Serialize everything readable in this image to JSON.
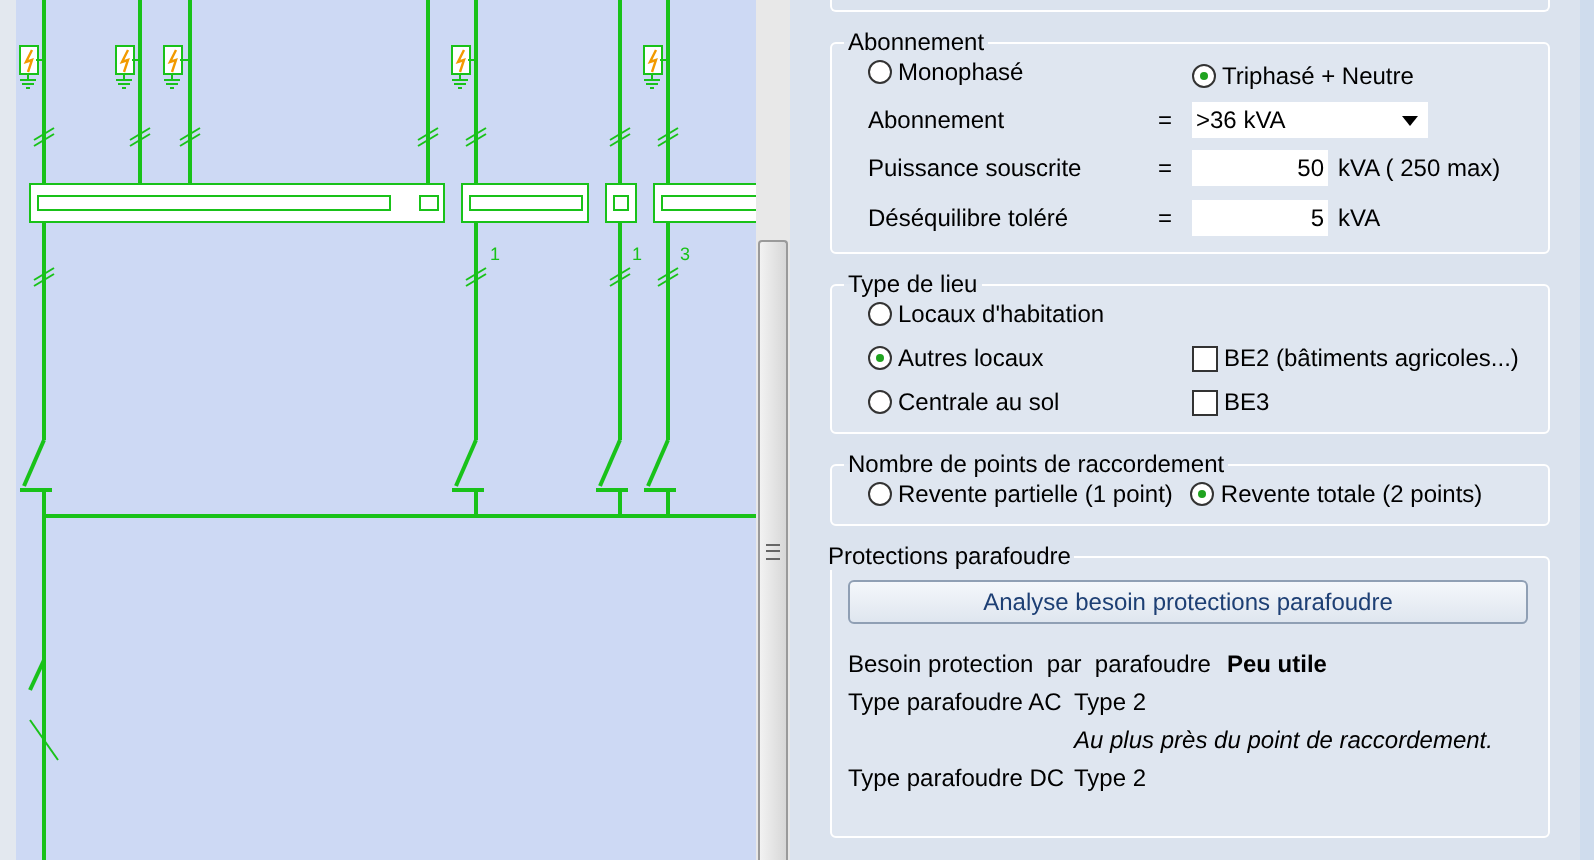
{
  "diagram": {
    "labels": [
      "1",
      "1",
      "3"
    ]
  },
  "abonnement": {
    "title": "Abonnement",
    "phases": [
      {
        "label": "Monophasé",
        "selected": false
      },
      {
        "label": "Triphasé + Neutre",
        "selected": true
      }
    ],
    "fields": [
      {
        "kind": "select",
        "label": "Abonnement",
        "operator": "=",
        "value": ">36 kVA"
      },
      {
        "kind": "input",
        "label": "Puissance souscrite",
        "operator": "=",
        "value": "50",
        "unit": "kVA ( 250 max)"
      },
      {
        "kind": "input",
        "label": "Déséquilibre toléré",
        "operator": "=",
        "value": "5",
        "unit": "kVA"
      }
    ]
  },
  "type_de_lieu": {
    "title": "Type de lieu",
    "options": [
      {
        "label": "Locaux d'habitation",
        "selected": false
      },
      {
        "label": "Autres locaux",
        "selected": true
      },
      {
        "label": "Centrale au sol",
        "selected": false
      }
    ],
    "checks": [
      {
        "label": "BE2 (bâtiments agricoles...)",
        "checked": false
      },
      {
        "label": "BE3",
        "checked": false
      }
    ]
  },
  "raccordement": {
    "title": "Nombre de points de raccordement",
    "options": [
      {
        "label": "Revente partielle (1 point)",
        "selected": false
      },
      {
        "label": "Revente totale (2 points)",
        "selected": true
      }
    ]
  },
  "protections": {
    "title": "Protections parafoudre",
    "button": "Analyse besoin protections parafoudre",
    "rows": [
      {
        "kind": "result",
        "label": "Besoin protection  par  parafoudre",
        "value": "Peu utile"
      },
      {
        "kind": "type",
        "label": "Type parafoudre AC",
        "value": "Type 2",
        "note": "Au plus près du point de raccordement."
      },
      {
        "kind": "type",
        "label": "Type parafoudre DC",
        "value": "Type 2"
      }
    ]
  }
}
